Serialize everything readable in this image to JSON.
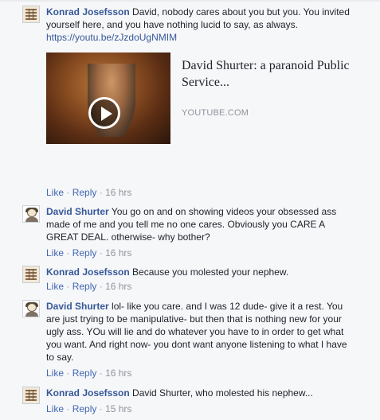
{
  "comments": [
    {
      "author": "Konrad Josefsson",
      "text": "David, nobody cares about you but you. You invited yourself here, and you have nothing lucid to say, as always.",
      "link": "https://youtu.be/zJzdoUgNMIM",
      "preview": {
        "title": "David Shurter: a paranoid Public Service...",
        "source": "YOUTUBE.COM"
      },
      "like": "Like",
      "reply": "Reply",
      "time": "16 hrs"
    },
    {
      "author": "David Shurter",
      "text": "You go on and on showing videos your obsessed ass made of me and you tell me no one cares. Obviously you CARE A GREAT DEAL. otherwise- why bother?",
      "like": "Like",
      "reply": "Reply",
      "time": "16 hrs"
    },
    {
      "author": "Konrad Josefsson",
      "text": "Because you molested your nephew.",
      "like": "Like",
      "reply": "Reply",
      "time": "16 hrs"
    },
    {
      "author": "David Shurter",
      "text": "lol- like you care. and I was 12 dude- give it a rest. You are just trying to be manipulative- but then that is nothing new for your ugly ass. YOu will lie and do whatever you have to in order to get what you want. And right now- you dont want anyone listening to what I have to say.",
      "like": "Like",
      "reply": "Reply",
      "time": "16 hrs"
    },
    {
      "author": "Konrad Josefsson",
      "text": "David Shurter, who molested his nephew...",
      "like": "Like",
      "reply": "Reply",
      "time": "15 hrs"
    }
  ],
  "separator": "·",
  "icons": {
    "konrad_avatar": "ladder-avatar-icon",
    "david_avatar": "face-avatar-icon",
    "play": "play-button-icon"
  },
  "colors": {
    "link": "#365899",
    "action": "#4267b2",
    "meta": "#90949c",
    "background": "#f6f7f9"
  }
}
